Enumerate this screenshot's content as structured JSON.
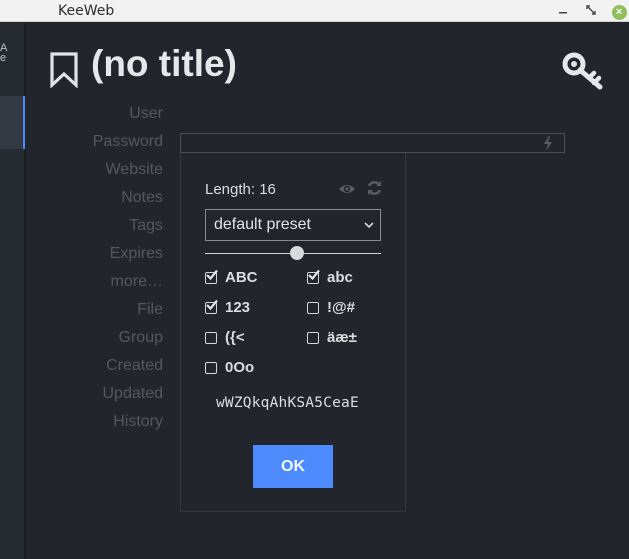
{
  "window": {
    "title": "KeeWeb"
  },
  "left_strip": {
    "glyph": "A\ne"
  },
  "entry": {
    "title": "(no title)"
  },
  "fields": [
    {
      "label": "User"
    },
    {
      "label": "Password"
    },
    {
      "label": "Website"
    },
    {
      "label": "Notes"
    },
    {
      "label": "Tags"
    },
    {
      "label": "Expires"
    },
    {
      "label": "more…"
    },
    {
      "label": "File"
    },
    {
      "label": "Group"
    },
    {
      "label": "Created"
    },
    {
      "label": "Updated"
    },
    {
      "label": "History"
    }
  ],
  "generator": {
    "length_label": "Length: 16",
    "length_value": 16,
    "slider_level": 0.52,
    "preset": "default preset",
    "options": [
      {
        "label": "ABC",
        "checked": true
      },
      {
        "label": "abc",
        "checked": true
      },
      {
        "label": "123",
        "checked": true
      },
      {
        "label": "!@#",
        "checked": false
      },
      {
        "label": "({<",
        "checked": false
      },
      {
        "label": "äæ±",
        "checked": false
      },
      {
        "label": "0Oo",
        "checked": false
      }
    ],
    "password": "wWZQkqAhKSA5CeaE",
    "ok_label": "OK"
  },
  "colors": {
    "accent": "#4d8bfd",
    "background": "#22262c",
    "titlebar": "#f2f2f2"
  },
  "icons": [
    "bookmark-icon",
    "key-icon",
    "bolt-icon",
    "eye-icon",
    "refresh-icon",
    "chevron-down-icon",
    "checkbox-icon"
  ]
}
